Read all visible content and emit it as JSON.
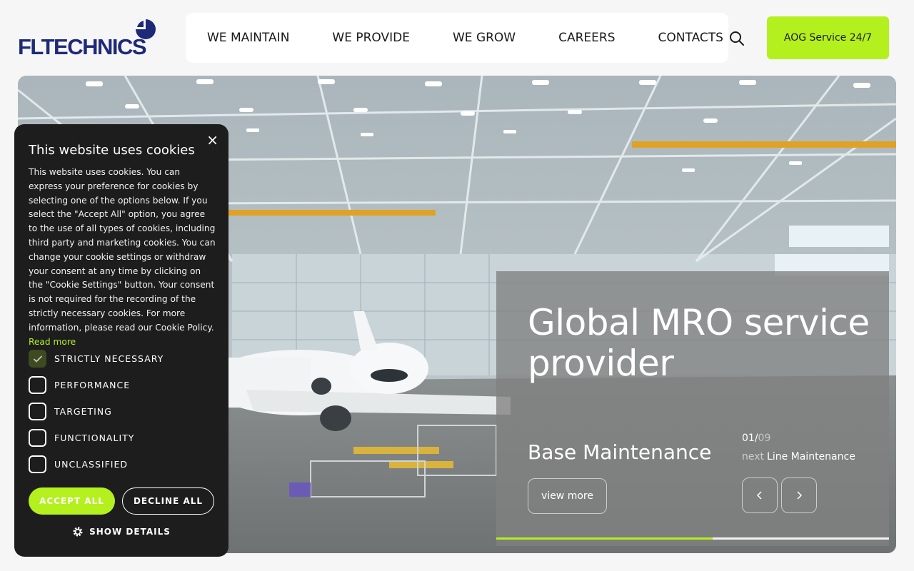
{
  "brand": {
    "logo_text": "FLTECHNICS",
    "accent_color": "#b4f01e",
    "logo_color": "#1e2a78"
  },
  "nav": {
    "items": [
      "WE MAINTAIN",
      "WE PROVIDE",
      "WE GROW",
      "CAREERS",
      "CONTACTS"
    ],
    "search_icon": "search-icon",
    "aog_label": "AOG Service 24/7"
  },
  "hero": {
    "title": "Global MRO service provider",
    "subtitle": "Base Maintenance",
    "counter_current": "01/",
    "counter_total": "09",
    "next_label": "next",
    "next_name": "Line Maintenance",
    "view_more": "view more",
    "slide_progress": 0.55
  },
  "cookie": {
    "title": "This website uses cookies",
    "body": "This website uses cookies. You can express your preference for cookies by selecting one of the options below. If you select the \"Accept All\" option, you agree to the use of all types of cookies, including third party and marketing cookies. You can change your cookie settings or withdraw your consent at any time by clicking on the \"Cookie Settings\" button. Your consent is not required for the recording of the strictly necessary cookies. For more information, please read our Cookie Policy.",
    "read_more": "Read more",
    "options": [
      {
        "label": "STRICTLY NECESSARY",
        "checked": true
      },
      {
        "label": "PERFORMANCE",
        "checked": false
      },
      {
        "label": "TARGETING",
        "checked": false
      },
      {
        "label": "FUNCTIONALITY",
        "checked": false
      },
      {
        "label": "UNCLASSIFIED",
        "checked": false
      }
    ],
    "accept_all": "ACCEPT ALL",
    "decline_all": "DECLINE ALL",
    "show_details": "SHOW DETAILS",
    "close": "×"
  }
}
